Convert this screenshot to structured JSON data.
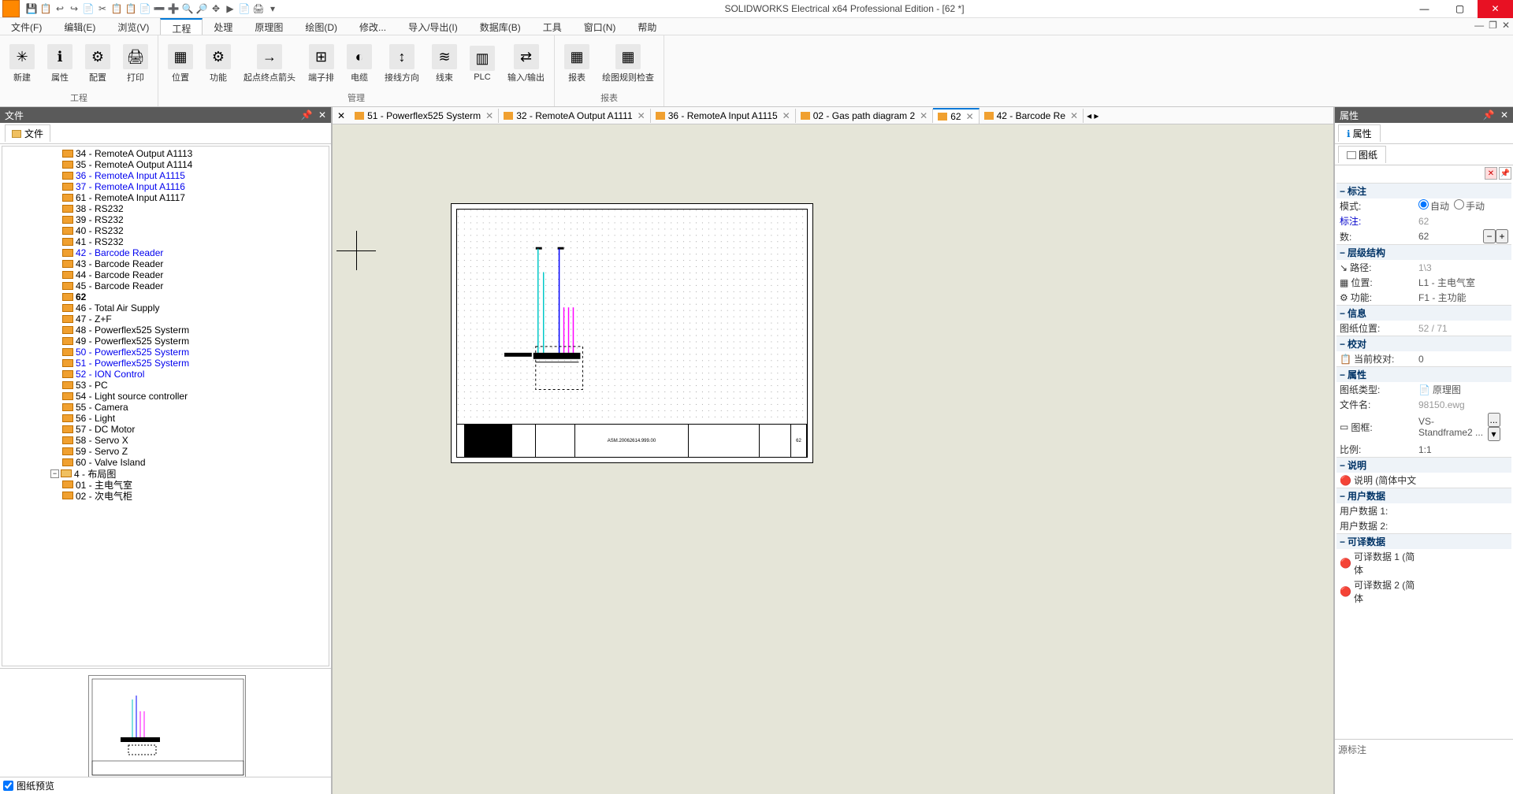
{
  "app": {
    "title": "SOLIDWORKS Electrical x64 Professional Edition - [62 *]",
    "qat": [
      "💾",
      "📋",
      "↩",
      "↪",
      "📄",
      "✂",
      "📋",
      "📋",
      "📄",
      "➖",
      "➕",
      "🔍",
      "🔎",
      "✥",
      "▶",
      "📄",
      "🖨",
      "▾"
    ]
  },
  "window_buttons": {
    "min": "—",
    "max": "▢",
    "close": "✕"
  },
  "mdi_buttons": {
    "min": "—",
    "restore": "❐",
    "close": "✕"
  },
  "menus": [
    {
      "label": "文件(F)"
    },
    {
      "label": "编辑(E)"
    },
    {
      "label": "浏览(V)"
    },
    {
      "label": "工程",
      "active": true
    },
    {
      "label": "处理"
    },
    {
      "label": "原理图"
    },
    {
      "label": "绘图(D)"
    },
    {
      "label": "修改..."
    },
    {
      "label": "导入/导出(I)"
    },
    {
      "label": "数据库(B)"
    },
    {
      "label": "工具"
    },
    {
      "label": "窗口(N)"
    },
    {
      "label": "帮助"
    }
  ],
  "ribbon": [
    {
      "title": "工程",
      "buttons": [
        {
          "icon": "✳",
          "label": "新建"
        },
        {
          "icon": "ℹ",
          "label": "属性"
        },
        {
          "icon": "⚙",
          "label": "配置"
        },
        {
          "icon": "🖨",
          "label": "打印"
        }
      ]
    },
    {
      "title": "管理",
      "buttons": [
        {
          "icon": "▦",
          "label": "位置"
        },
        {
          "icon": "⚙",
          "label": "功能"
        },
        {
          "icon": "→",
          "label": "起点终点箭头"
        },
        {
          "icon": "⊞",
          "label": "端子排"
        },
        {
          "icon": "◐",
          "label": "电缆"
        },
        {
          "icon": "↕",
          "label": "接线方向"
        },
        {
          "icon": "≋",
          "label": "线束"
        },
        {
          "icon": "▥",
          "label": "PLC"
        },
        {
          "icon": "⇄",
          "label": "输入/输出"
        }
      ]
    },
    {
      "title": "报表",
      "buttons": [
        {
          "icon": "▦",
          "label": "报表"
        },
        {
          "icon": "▦",
          "label": "绘图规则检查"
        }
      ]
    }
  ],
  "left_panel": {
    "header": "文件",
    "tab": "文件",
    "preview_label": "图纸预览",
    "tree": [
      {
        "label": "34 - RemoteA Output A1113",
        "indent": 70
      },
      {
        "label": "35 - RemoteA Output A1114",
        "indent": 70
      },
      {
        "label": "36 - RemoteA Input A1115",
        "indent": 70,
        "blue": true
      },
      {
        "label": "37 - RemoteA Input A1116",
        "indent": 70,
        "blue": true
      },
      {
        "label": "61 - RemoteA Input A1117",
        "indent": 70
      },
      {
        "label": "38 - RS232",
        "indent": 70
      },
      {
        "label": "39 - RS232",
        "indent": 70
      },
      {
        "label": "40 - RS232",
        "indent": 70
      },
      {
        "label": "41 - RS232",
        "indent": 70
      },
      {
        "label": "42 - Barcode Reader",
        "indent": 70,
        "blue": true
      },
      {
        "label": "43 - Barcode Reader",
        "indent": 70
      },
      {
        "label": "44 - Barcode Reader",
        "indent": 70
      },
      {
        "label": "45 - Barcode Reader",
        "indent": 70
      },
      {
        "label": "62",
        "indent": 70,
        "bold": true
      },
      {
        "label": "46 - Total Air Supply",
        "indent": 70
      },
      {
        "label": "47 - Z+F",
        "indent": 70
      },
      {
        "label": "48 - Powerflex525 Systerm",
        "indent": 70
      },
      {
        "label": "49 - Powerflex525 Systerm",
        "indent": 70
      },
      {
        "label": "50 - Powerflex525 Systerm",
        "indent": 70,
        "blue": true
      },
      {
        "label": "51 - Powerflex525 Systerm",
        "indent": 70,
        "blue": true
      },
      {
        "label": "52 - ION Control",
        "indent": 70,
        "blue": true
      },
      {
        "label": "53 - PC",
        "indent": 70
      },
      {
        "label": "54 - Light source controller",
        "indent": 70
      },
      {
        "label": "55 - Camera",
        "indent": 70
      },
      {
        "label": "56 - Light",
        "indent": 70
      },
      {
        "label": "57 - DC Motor",
        "indent": 70
      },
      {
        "label": "58 - Servo X",
        "indent": 70
      },
      {
        "label": "59 - Servo Z",
        "indent": 70
      },
      {
        "label": "60 - Valve Island",
        "indent": 70
      },
      {
        "label": "4 - 布局图",
        "indent": 55,
        "folder": true
      },
      {
        "label": "01 - 主电气室",
        "indent": 70
      },
      {
        "label": "02 - 次电气柜",
        "indent": 70
      }
    ]
  },
  "doc_tabs": [
    {
      "label": "51 - Powerflex525 Systerm"
    },
    {
      "label": "32 - RemoteA Output A1111"
    },
    {
      "label": "36 - RemoteA Input A1115"
    },
    {
      "label": "02 - Gas path diagram 2"
    },
    {
      "label": "62",
      "active": true
    },
    {
      "label": "42 - Barcode Re"
    }
  ],
  "drawing": {
    "block_text": "ASM.20062614.999.00",
    "num": "62"
  },
  "right_panel": {
    "header": "属性",
    "tab": "属性",
    "subtab": "图纸",
    "delete_icon": "✕",
    "pin_icon": "📌",
    "sections": [
      {
        "title": "标注",
        "rows": [
          {
            "k": "模式:",
            "v_radio": [
              "自动",
              "手动"
            ],
            "selected": 0
          },
          {
            "k": "标注:",
            "v": "62",
            "kblue": true,
            "vgray": true
          },
          {
            "k": "数:",
            "v": "62",
            "buttons": true
          }
        ]
      },
      {
        "title": "层级结构",
        "rows": [
          {
            "k": "路径:",
            "v": "1\\3",
            "icon": "↘",
            "vgray": true
          },
          {
            "k": "位置:",
            "v": "L1 - 主电气室",
            "icon": "▦"
          },
          {
            "k": "功能:",
            "v": "F1 - 主功能",
            "icon": "⚙"
          }
        ]
      },
      {
        "title": "信息",
        "rows": [
          {
            "k": "图纸位置:",
            "v": "52 / 71",
            "vgray": true
          }
        ]
      },
      {
        "title": "校对",
        "rows": [
          {
            "k": "当前校对:",
            "v": "0",
            "icon": "📋"
          }
        ]
      },
      {
        "title": "属性",
        "rows": [
          {
            "k": "图纸类型:",
            "v": "原理图",
            "vicon": "📄"
          },
          {
            "k": "文件名:",
            "v": "98150.ewg",
            "vgray": true
          },
          {
            "k": "图框:",
            "v": "VS-Standframe2 ...",
            "icon": "▭",
            "dropdown": true
          },
          {
            "k": "比例:",
            "v": "1:1"
          }
        ]
      },
      {
        "title": "说明",
        "rows": [
          {
            "k": "说明 (简体中文",
            "icon": "🔴"
          }
        ]
      },
      {
        "title": "用户数据",
        "rows": [
          {
            "k": "用户数据 1:"
          },
          {
            "k": "用户数据 2:"
          }
        ]
      },
      {
        "title": "可译数据",
        "rows": [
          {
            "k": "可译数据 1 (简体",
            "icon": "🔴"
          },
          {
            "k": "可译数据 2 (简体",
            "icon": "🔴"
          }
        ]
      }
    ],
    "source_label": "源标注"
  }
}
